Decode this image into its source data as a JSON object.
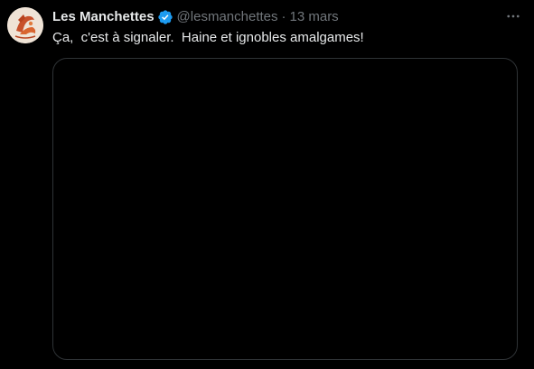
{
  "tweet": {
    "author": {
      "display_name": "Les Manchettes",
      "handle": "@lesmanchettes",
      "verified": true,
      "avatar_icon": "avatar-logo-icon"
    },
    "separator": "·",
    "timestamp": "13 mars",
    "text": "Ça,  c'est à signaler.  Haine et ignobles amalgames!",
    "more_icon": "more-options-icon"
  },
  "colors": {
    "background": "#000000",
    "text_primary": "#e7e9ea",
    "text_secondary": "#71767b",
    "verified_blue": "#1d9bf0",
    "border": "#2f3336"
  }
}
